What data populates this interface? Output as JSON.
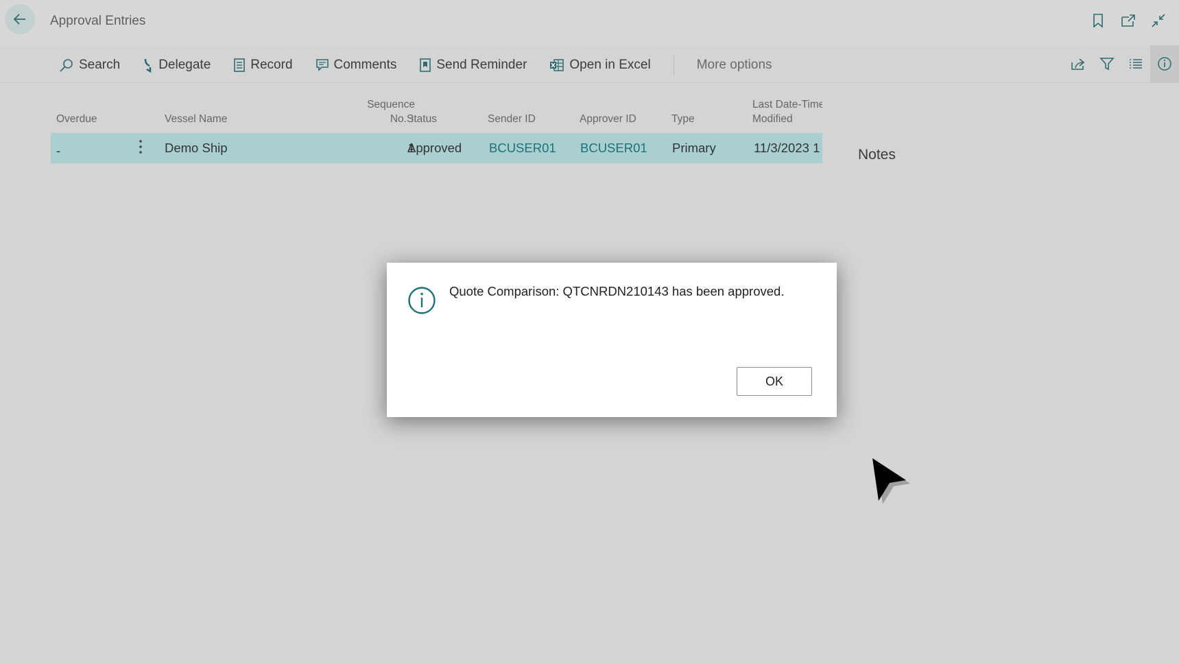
{
  "header": {
    "title": "Approval Entries"
  },
  "top_icons": [
    "bookmark-icon",
    "open-new-window-icon",
    "collapse-icon"
  ],
  "actions": [
    {
      "label": "Search",
      "icon": "search-icon"
    },
    {
      "label": "Delegate",
      "icon": "delegate-arrow-icon"
    },
    {
      "label": "Record",
      "icon": "record-document-icon"
    },
    {
      "label": "Comments",
      "icon": "comments-icon"
    },
    {
      "label": "Send Reminder",
      "icon": "send-reminder-icon"
    },
    {
      "label": "Open in Excel",
      "icon": "excel-icon"
    }
  ],
  "more_options": "More options",
  "right_actions": [
    "share-icon",
    "filter-icon",
    "list-view-icon",
    "info-icon"
  ],
  "table": {
    "columns": {
      "overdue": "Overdue",
      "vessel_name": "Vessel Name",
      "sequence_line1": "Sequence",
      "sequence_line2": "No.",
      "sort_arrow": "↑",
      "status": "Status",
      "sender_id": "Sender ID",
      "approver_id": "Approver ID",
      "type": "Type",
      "modified_line1": "Last Date-Time",
      "modified_line2": "Modified"
    },
    "rows": [
      {
        "overdue": "-",
        "vessel_name": "Demo Ship",
        "sequence_no": "1",
        "status": "Approved",
        "sender_id": "BCUSER01",
        "approver_id": "BCUSER01",
        "type": "Primary",
        "last_modified": "11/3/2023 1"
      }
    ]
  },
  "factbox": {
    "notes_title": "Notes"
  },
  "dialog": {
    "message": "Quote Comparison: QTCNRDN210143 has been approved.",
    "ok_label": "OK",
    "icon": "info-icon"
  },
  "colors": {
    "selected_row": "#a9cfd1",
    "accent": "#1f7179",
    "page_background": "#d4d4d4"
  }
}
